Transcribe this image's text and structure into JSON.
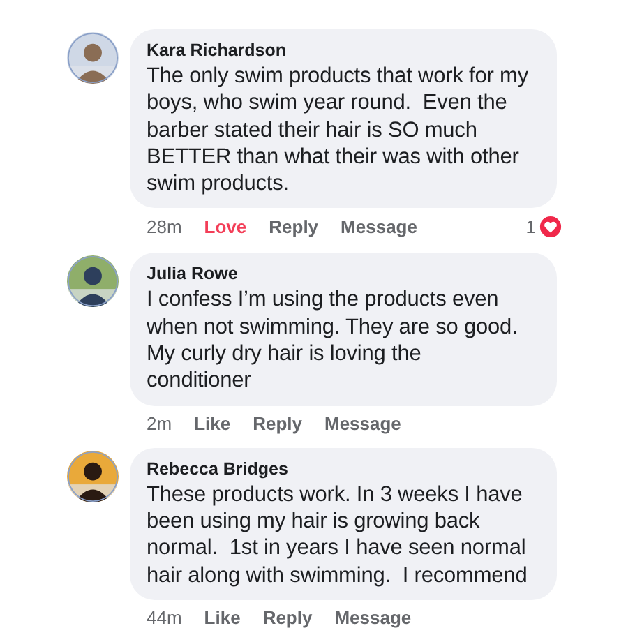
{
  "comments": [
    {
      "author": "Kara Richardson",
      "avatar": {
        "kind": "picture"
      },
      "lines": [
        "The only swim products that work for my",
        "boys, who swim year round.  Even the",
        "barber stated their hair is SO much",
        "BETTER than what their was with other",
        "swim products."
      ],
      "time": "28m",
      "actions": [
        {
          "label": "Love",
          "selected": true
        },
        {
          "label": "Reply",
          "selected": false
        },
        {
          "label": "Message",
          "selected": false
        }
      ],
      "reaction_count": "1"
    },
    {
      "author": "Julia Rowe",
      "avatar": {
        "kind": "picture"
      },
      "lines": [
        "I confess I’m using the products even",
        "when not swimming. They are so good.",
        "My curly dry hair is loving the",
        "conditioner"
      ],
      "time": "2m",
      "actions": [
        {
          "label": "Like",
          "selected": false
        },
        {
          "label": "Reply",
          "selected": false
        },
        {
          "label": "Message",
          "selected": false
        }
      ]
    },
    {
      "author": "Rebecca Bridges",
      "avatar": {
        "kind": "picture"
      },
      "lines": [
        "These products work. In 3 weeks I have",
        "been using my hair is growing back",
        "normal.  1st in years I have seen normal",
        "hair along with swimming.  I recommend"
      ],
      "time": "44m",
      "actions": [
        {
          "label": "Like",
          "selected": false
        },
        {
          "label": "Reply",
          "selected": false
        },
        {
          "label": "Message",
          "selected": false
        }
      ]
    }
  ]
}
